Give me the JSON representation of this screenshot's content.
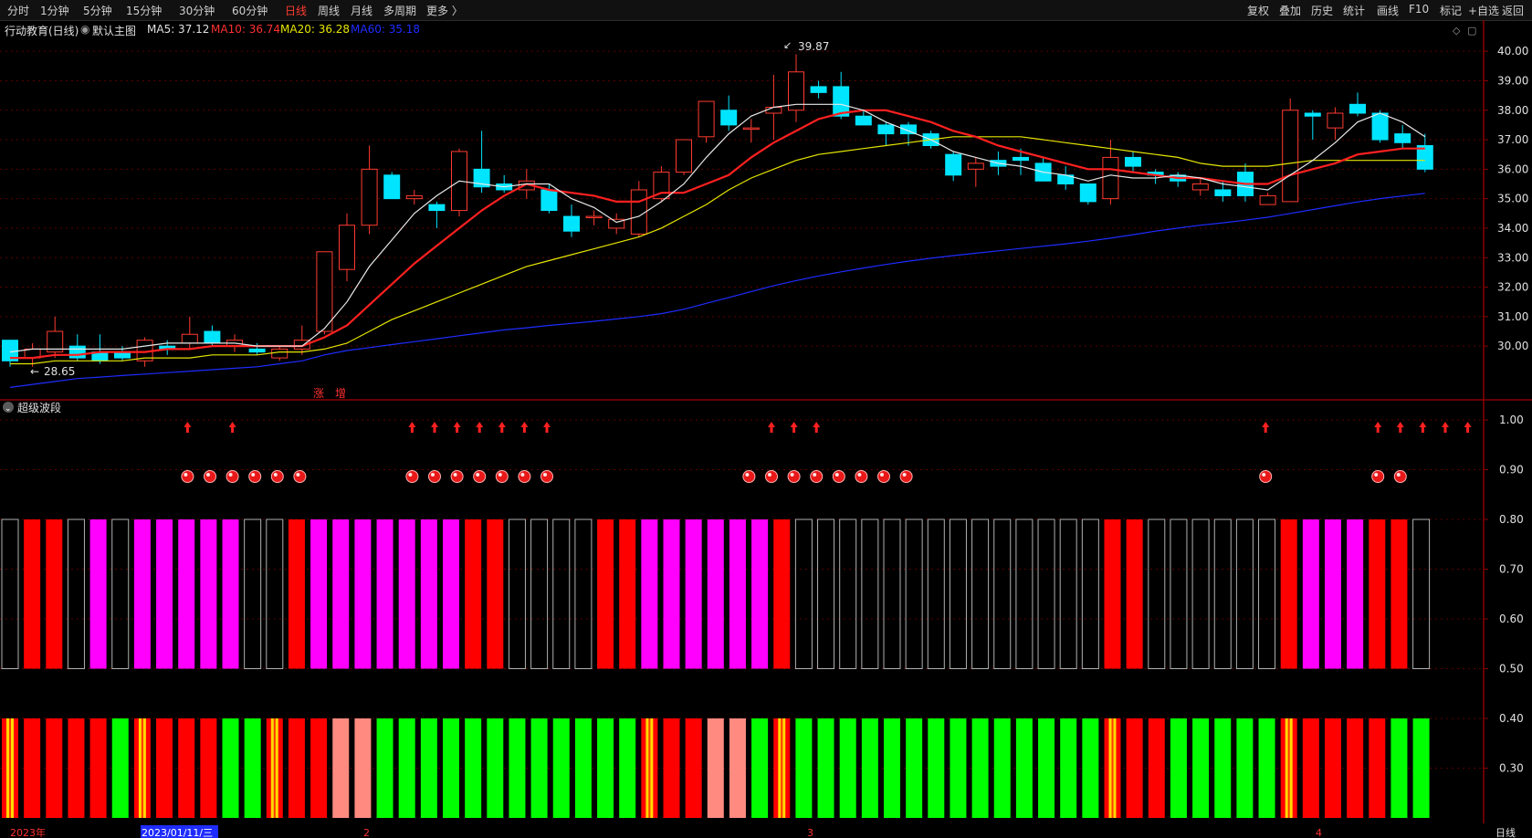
{
  "toolbar": {
    "left_items": [
      "分时",
      "1分钟",
      "5分钟",
      "15分钟",
      "30分钟",
      "60分钟",
      "日线",
      "周线",
      "月线",
      "多周期",
      "更多 〉"
    ],
    "active": "日线",
    "right_items": [
      "复权",
      "叠加",
      "历史",
      "统计",
      "画线",
      "F10",
      "标记",
      "+自选",
      "返回"
    ]
  },
  "info": {
    "stock": "行动教育(日线)",
    "template": "默认主图",
    "ma5": "MA5: 37.12",
    "ma10": "MA10: 36.74",
    "ma20": "MA20: 36.28",
    "ma60": "MA60: 35.18"
  },
  "colors": {
    "up": "#ff3b30",
    "down": "#00e5ff",
    "ma5": "#e8e8e8",
    "ma10": "#ff2020",
    "ma20": "#e6e600",
    "ma60": "#1e2cff",
    "magenta": "#ff00ff",
    "green": "#00ff00",
    "salmon": "#ff8a80",
    "grid": "#5a0000"
  },
  "price_axis": {
    "min": 28.0,
    "max": 40.5,
    "ticks": [
      "40.00",
      "39.00",
      "38.00",
      "37.00",
      "36.00",
      "35.00",
      "34.00",
      "33.00",
      "32.00",
      "31.00",
      "30.00"
    ]
  },
  "indicator_axis": {
    "ticks": [
      "1.00",
      "0.90",
      "0.80",
      "0.70",
      "0.60",
      "0.50",
      "0.40",
      "0.30"
    ]
  },
  "annotations": {
    "high_label": "39.87",
    "low_label": "28.65",
    "zhang": "涨",
    "zeng": "增"
  },
  "indicator_title": "超级波段",
  "date_labels": {
    "year": "2023年",
    "cursor_date": "2023/01/11/三",
    "m2": "2",
    "m3": "3",
    "m4": "4",
    "period": "日线"
  },
  "chart_data": {
    "type": "candlestick",
    "candles_ohlc": [
      [
        30.2,
        30.1,
        29.3,
        29.5
      ],
      [
        29.6,
        30.1,
        29.3,
        29.9
      ],
      [
        29.8,
        31.0,
        29.6,
        30.5
      ],
      [
        30.0,
        30.4,
        29.5,
        29.6
      ],
      [
        29.8,
        30.4,
        29.4,
        29.5
      ],
      [
        29.8,
        30.0,
        29.5,
        29.6
      ],
      [
        29.5,
        30.3,
        29.3,
        30.2
      ],
      [
        30.0,
        30.2,
        29.7,
        29.9
      ],
      [
        30.1,
        31.0,
        29.9,
        30.4
      ],
      [
        30.5,
        30.7,
        30.0,
        30.1
      ],
      [
        30.0,
        30.4,
        29.8,
        30.2
      ],
      [
        29.9,
        30.1,
        29.7,
        29.8
      ],
      [
        29.6,
        30.0,
        29.5,
        29.9
      ],
      [
        29.9,
        30.7,
        29.7,
        30.2
      ],
      [
        30.5,
        32.5,
        30.4,
        33.2
      ],
      [
        32.6,
        34.5,
        32.2,
        34.1
      ],
      [
        34.1,
        36.8,
        33.8,
        36.0
      ],
      [
        35.8,
        35.9,
        35.0,
        35.0
      ],
      [
        35.0,
        35.3,
        34.8,
        35.1
      ],
      [
        34.8,
        34.9,
        34.0,
        34.6
      ],
      [
        34.6,
        36.7,
        34.4,
        36.6
      ],
      [
        36.0,
        37.3,
        35.2,
        35.4
      ],
      [
        35.5,
        35.8,
        35.2,
        35.3
      ],
      [
        35.3,
        36.0,
        35.0,
        35.6
      ],
      [
        35.3,
        35.5,
        34.5,
        34.6
      ],
      [
        34.4,
        34.8,
        33.7,
        33.9
      ],
      [
        34.4,
        34.6,
        34.1,
        34.4
      ],
      [
        34.0,
        34.5,
        33.8,
        34.3
      ],
      [
        33.8,
        35.6,
        33.7,
        35.3
      ],
      [
        35.0,
        36.1,
        34.9,
        35.9
      ],
      [
        35.9,
        37.0,
        35.8,
        37.0
      ],
      [
        37.1,
        38.3,
        36.9,
        38.3
      ],
      [
        38.0,
        38.5,
        37.3,
        37.5
      ],
      [
        37.4,
        37.7,
        36.9,
        37.4
      ],
      [
        37.9,
        39.2,
        37.0,
        38.1
      ],
      [
        38.0,
        39.9,
        37.6,
        39.3
      ],
      [
        38.8,
        39.0,
        38.4,
        38.6
      ],
      [
        38.8,
        39.3,
        37.7,
        37.8
      ],
      [
        37.8,
        38.0,
        37.5,
        37.5
      ],
      [
        37.5,
        37.6,
        36.8,
        37.2
      ],
      [
        37.5,
        37.6,
        36.8,
        37.2
      ],
      [
        37.2,
        37.3,
        36.7,
        36.8
      ],
      [
        36.5,
        36.6,
        35.6,
        35.8
      ],
      [
        36.0,
        36.4,
        35.4,
        36.2
      ],
      [
        36.3,
        36.6,
        35.8,
        36.1
      ],
      [
        36.4,
        36.7,
        35.8,
        36.3
      ],
      [
        36.2,
        36.4,
        35.6,
        35.6
      ],
      [
        35.8,
        36.1,
        35.3,
        35.5
      ],
      [
        35.5,
        35.5,
        34.8,
        34.9
      ],
      [
        35.0,
        37.0,
        34.8,
        36.4
      ],
      [
        36.4,
        36.6,
        35.9,
        36.1
      ],
      [
        35.9,
        36.0,
        35.5,
        35.8
      ],
      [
        35.8,
        35.9,
        35.4,
        35.6
      ],
      [
        35.3,
        35.7,
        35.1,
        35.5
      ],
      [
        35.3,
        35.6,
        34.9,
        35.1
      ],
      [
        35.9,
        36.2,
        34.9,
        35.1
      ],
      [
        34.8,
        35.2,
        34.8,
        35.1
      ],
      [
        34.9,
        38.4,
        34.9,
        38.0
      ],
      [
        37.9,
        38.0,
        37.0,
        37.8
      ],
      [
        37.4,
        38.1,
        37.0,
        37.9
      ],
      [
        38.2,
        38.6,
        37.8,
        37.9
      ],
      [
        37.9,
        38.0,
        36.9,
        37.0
      ],
      [
        37.2,
        37.5,
        36.7,
        36.9
      ],
      [
        36.8,
        37.2,
        35.9,
        36.0
      ]
    ],
    "ma5": [
      29.8,
      29.9,
      29.9,
      29.9,
      29.9,
      29.9,
      30.0,
      30.1,
      30.1,
      30.1,
      30.1,
      30.0,
      30.0,
      30.0,
      30.6,
      31.5,
      32.7,
      33.6,
      34.5,
      35.1,
      35.6,
      35.5,
      35.4,
      35.5,
      35.5,
      35.0,
      34.7,
      34.2,
      34.4,
      34.9,
      35.5,
      36.4,
      37.2,
      37.8,
      38.1,
      38.2,
      38.2,
      38.2,
      38.0,
      37.6,
      37.3,
      37.0,
      36.6,
      36.4,
      36.2,
      36.1,
      35.9,
      35.8,
      35.6,
      35.8,
      35.7,
      35.7,
      35.8,
      35.7,
      35.5,
      35.4,
      35.3,
      35.8,
      36.3,
      36.9,
      37.6,
      37.9,
      37.6,
      37.1
    ],
    "ma10": [
      29.6,
      29.6,
      29.7,
      29.7,
      29.8,
      29.8,
      29.8,
      29.9,
      29.9,
      30.0,
      30.0,
      30.0,
      30.0,
      30.0,
      30.3,
      30.7,
      31.4,
      32.1,
      32.8,
      33.4,
      34.0,
      34.6,
      35.1,
      35.5,
      35.3,
      35.2,
      35.1,
      34.9,
      34.9,
      35.2,
      35.2,
      35.5,
      35.8,
      36.4,
      36.9,
      37.3,
      37.7,
      37.9,
      38.0,
      38.0,
      37.8,
      37.6,
      37.3,
      37.1,
      36.8,
      36.6,
      36.4,
      36.2,
      36.0,
      36.0,
      35.9,
      35.8,
      35.7,
      35.7,
      35.6,
      35.5,
      35.5,
      35.8,
      36.0,
      36.2,
      36.5,
      36.6,
      36.7,
      36.7
    ],
    "ma20": [
      29.4,
      29.4,
      29.5,
      29.5,
      29.5,
      29.5,
      29.6,
      29.6,
      29.6,
      29.7,
      29.7,
      29.7,
      29.8,
      29.8,
      29.9,
      30.1,
      30.5,
      30.9,
      31.2,
      31.5,
      31.8,
      32.1,
      32.4,
      32.7,
      32.9,
      33.1,
      33.3,
      33.5,
      33.7,
      34.0,
      34.4,
      34.8,
      35.3,
      35.7,
      36.0,
      36.3,
      36.5,
      36.6,
      36.7,
      36.8,
      36.9,
      37.0,
      37.1,
      37.1,
      37.1,
      37.1,
      37.0,
      36.9,
      36.8,
      36.7,
      36.6,
      36.5,
      36.4,
      36.2,
      36.1,
      36.1,
      36.1,
      36.2,
      36.3,
      36.3,
      36.3,
      36.3,
      36.3,
      36.3
    ],
    "ma60": [
      28.6,
      28.7,
      28.8,
      28.9,
      28.95,
      29.0,
      29.05,
      29.1,
      29.15,
      29.2,
      29.25,
      29.3,
      29.4,
      29.5,
      29.7,
      29.85,
      29.95,
      30.05,
      30.15,
      30.25,
      30.35,
      30.45,
      30.55,
      30.62,
      30.7,
      30.77,
      30.84,
      30.92,
      31.0,
      31.1,
      31.25,
      31.45,
      31.65,
      31.85,
      32.05,
      32.22,
      32.38,
      32.52,
      32.65,
      32.77,
      32.88,
      32.98,
      33.07,
      33.15,
      33.23,
      33.31,
      33.39,
      33.47,
      33.56,
      33.66,
      33.78,
      33.9,
      34.0,
      34.1,
      34.18,
      34.27,
      34.37,
      34.5,
      34.63,
      34.76,
      34.89,
      35.0,
      35.09,
      35.18
    ],
    "arrows_idx": [
      4,
      6,
      14,
      15,
      16,
      17,
      18,
      19,
      20,
      30,
      31,
      32,
      52,
      57,
      58,
      59,
      60,
      61
    ],
    "balls_idx": [
      4,
      5,
      6,
      7,
      8,
      9,
      14,
      15,
      16,
      17,
      18,
      19,
      20,
      29,
      30,
      31,
      32,
      33,
      34,
      35,
      36,
      52,
      57,
      58
    ],
    "upper_bars": [
      "o",
      "r",
      "r",
      "o",
      "m",
      "o",
      "m",
      "m",
      "m",
      "m",
      "m",
      "o",
      "o",
      "r",
      "m",
      "m",
      "m",
      "m",
      "m",
      "m",
      "m",
      "r",
      "r",
      "o",
      "o",
      "o",
      "o",
      "r",
      "r",
      "m",
      "m",
      "m",
      "m",
      "m",
      "m",
      "r",
      "o",
      "o",
      "o",
      "o",
      "o",
      "o",
      "o",
      "o",
      "o",
      "o",
      "o",
      "o",
      "o",
      "o",
      "r",
      "r",
      "o",
      "o",
      "o",
      "o",
      "o",
      "o",
      "r",
      "m",
      "m",
      "m",
      "r",
      "r",
      "o"
    ],
    "lower_bars": [
      "y",
      "r",
      "r",
      "r",
      "r",
      "g",
      "y",
      "r",
      "r",
      "r",
      "g",
      "g",
      "y",
      "r",
      "r",
      "s",
      "s",
      "g",
      "g",
      "g",
      "g",
      "g",
      "g",
      "g",
      "g",
      "g",
      "g",
      "g",
      "g",
      "y",
      "r",
      "r",
      "s",
      "s",
      "g",
      "y",
      "g",
      "g",
      "g",
      "g",
      "g",
      "g",
      "g",
      "g",
      "g",
      "g",
      "g",
      "g",
      "g",
      "g",
      "y",
      "r",
      "r",
      "g",
      "g",
      "g",
      "g",
      "g",
      "y",
      "r",
      "r",
      "r",
      "r",
      "g",
      "g"
    ]
  }
}
